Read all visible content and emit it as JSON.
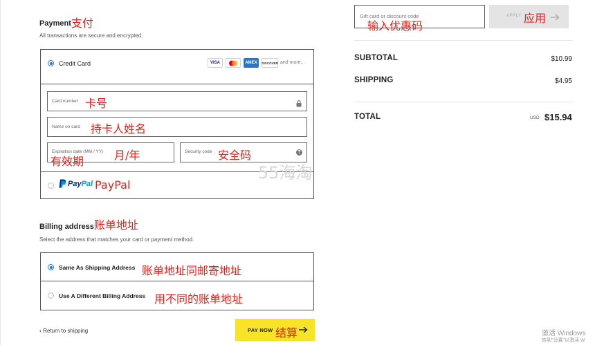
{
  "payment": {
    "heading": "Payment",
    "heading_note": "支付",
    "secure_text": "All transactions are secure and encrypted.",
    "credit_card": {
      "label": "Credit Card",
      "logos": [
        "VISA",
        "MC",
        "AMEX",
        "DISCOVER"
      ],
      "more": "and more...",
      "card_number_placeholder": "Card number",
      "card_number_note": "卡号",
      "name_placeholder": "Name on card",
      "name_note": "持卡人姓名",
      "expiry_placeholder": "Expiration date (MM / YY)",
      "expiry_note_left": "有效期",
      "expiry_note_right": "月/年",
      "security_placeholder": "Security code",
      "security_note": "安全码",
      "help_glyph": "?"
    },
    "paypal": {
      "brand_pay": "Pay",
      "brand_pal": "Pal",
      "note": "PayPal"
    }
  },
  "billing": {
    "heading": "Billing address",
    "heading_note": "账单地址",
    "sub_text": "Select the address that matches your card or payment method.",
    "same_label": "Same As Shipping Address",
    "same_note": "账单地址同邮寄地址",
    "different_label": "Use A Different Billing Address",
    "different_note": "用不同的账单地址"
  },
  "footer": {
    "return_label": "Return to shipping",
    "paynow_label": "PAY NOW",
    "paynow_note": "结算"
  },
  "summary": {
    "gift_placeholder": "Gift card or discount code",
    "gift_note": "输入优惠码",
    "apply_label": "APPLY",
    "apply_note": "应用",
    "subtotal_label": "SUBTOTAL",
    "subtotal_value": "$10.99",
    "shipping_label": "SHIPPING",
    "shipping_value": "$4.95",
    "total_label": "TOTAL",
    "total_currency": "USD",
    "total_value": "$15.94"
  },
  "watermark": {
    "site": "55海淘",
    "os_line1": "激活 Windows",
    "os_line2": "转到\"设置\"以激活 W"
  },
  "colors": {
    "accent_yellow": "#f7e42a",
    "annotation_red": "#e8201b",
    "radio_blue": "#1a73e8",
    "paypal_dark": "#003087",
    "paypal_light": "#009cde"
  }
}
